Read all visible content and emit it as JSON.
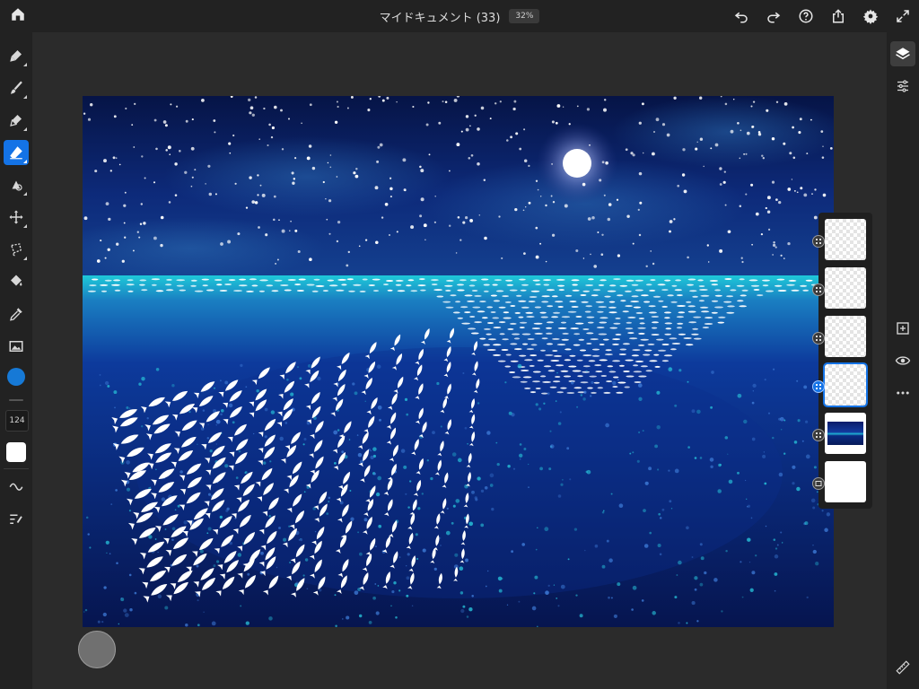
{
  "header": {
    "title": "マイドキュメント (33)",
    "zoom": "32%"
  },
  "icons": {
    "home": "home-icon",
    "undo": "undo-icon",
    "redo": "redo-icon",
    "help": "help-icon",
    "share": "share-icon",
    "settings": "gear-icon",
    "fullscreen": "expand-icon"
  },
  "toolbar": {
    "brush_size": "124",
    "active_tool": "eraser",
    "current_color": "#1679d6"
  },
  "layers": {
    "count": 6,
    "selected_index": 3
  }
}
